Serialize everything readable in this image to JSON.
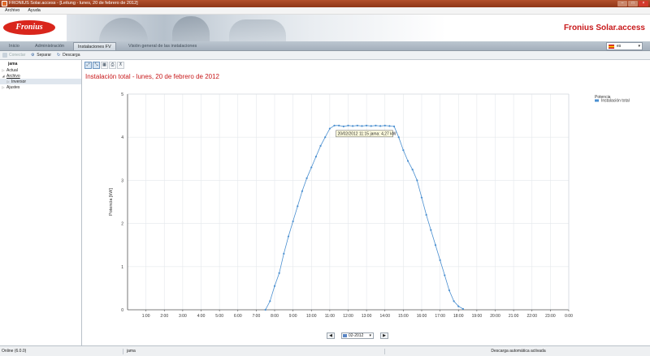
{
  "window": {
    "title": "FRONIUS Solar.access - [Leitung - lunes, 20 de febrero de 2012]"
  },
  "menu": [
    "Archivo",
    "Ayuda"
  ],
  "header": {
    "logo": "Fronius",
    "brand": "Fronius Solar.access"
  },
  "nav": {
    "tabs": [
      "Inicio",
      "Administración",
      "Instalaciones FV",
      "Visión general de las instalaciones"
    ],
    "active_index": 2,
    "language": "es"
  },
  "toolbar": {
    "connect": "Conectar",
    "disconnect": "Separar",
    "download": "Descarga"
  },
  "tree": {
    "root": "jama",
    "items": [
      {
        "label": "Actual",
        "level": 1,
        "expander": "+"
      },
      {
        "label": "Archivo",
        "level": 1,
        "expander": "-"
      },
      {
        "label": "Inversor",
        "level": 2,
        "expander": "+",
        "selected": true
      },
      {
        "label": "Ajustes",
        "level": 1,
        "expander": "+"
      }
    ]
  },
  "page_title": "Instalación total - lunes, 20 de febrero de 2012",
  "pager": {
    "month": "02-2012"
  },
  "status": {
    "connection": "Online (6.0.0)",
    "site": "jama",
    "download": "Descarga automática activada"
  },
  "colors": {
    "accent_red": "#c8191b",
    "series_blue": "#4a8fd0"
  },
  "chart_data": {
    "type": "line",
    "ylabel": "Potencia [kW]",
    "xlabel": "",
    "ylim": [
      0,
      5
    ],
    "yticks": [
      "0",
      "1",
      "2",
      "3",
      "4",
      "5"
    ],
    "xlim": [
      0,
      24
    ],
    "xticks": [
      "1:00",
      "2:00",
      "3:00",
      "4:00",
      "5:00",
      "6:00",
      "7:00",
      "8:00",
      "9:00",
      "10:00",
      "11:00",
      "12:00",
      "13:00",
      "14:00",
      "15:00",
      "16:00",
      "17:00",
      "18:00",
      "19:00",
      "20:00",
      "21:00",
      "22:00",
      "23:00",
      "0:00"
    ],
    "grid": true,
    "legend": {
      "title": "Potencia",
      "entries": [
        "Instalación total"
      ],
      "placement": "right"
    },
    "series": [
      {
        "name": "Instalación total",
        "x": [
          7.5,
          7.75,
          8.0,
          8.25,
          8.5,
          8.75,
          9.0,
          9.25,
          9.5,
          9.75,
          10.0,
          10.25,
          10.5,
          10.75,
          11.0,
          11.25,
          11.5,
          11.75,
          12.0,
          12.25,
          12.5,
          12.75,
          13.0,
          13.25,
          13.5,
          13.75,
          14.0,
          14.25,
          14.5,
          14.75,
          15.0,
          15.25,
          15.5,
          15.75,
          16.0,
          16.25,
          16.5,
          16.75,
          17.0,
          17.25,
          17.5,
          17.75,
          18.0,
          18.25
        ],
        "y": [
          0.0,
          0.2,
          0.55,
          0.85,
          1.3,
          1.7,
          2.05,
          2.4,
          2.75,
          3.05,
          3.3,
          3.55,
          3.8,
          4.0,
          4.2,
          4.27,
          4.27,
          4.25,
          4.27,
          4.26,
          4.27,
          4.26,
          4.27,
          4.26,
          4.27,
          4.26,
          4.27,
          4.26,
          4.25,
          4.0,
          3.7,
          3.45,
          3.25,
          3.0,
          2.6,
          2.2,
          1.85,
          1.5,
          1.15,
          0.8,
          0.45,
          0.2,
          0.08,
          0.02
        ]
      }
    ],
    "tooltip": "20/02/2012 11:15 jama: 4,27 kW"
  }
}
